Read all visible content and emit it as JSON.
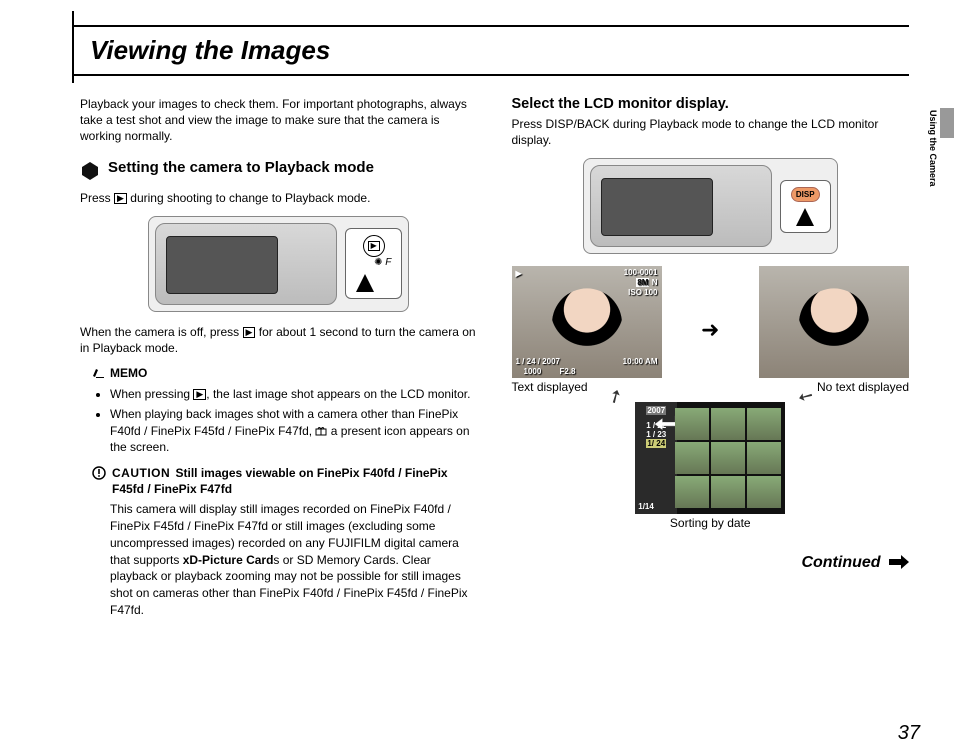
{
  "page_title": "Viewing the Images",
  "page_number": "37",
  "side_tab": "Using the Camera",
  "left": {
    "intro": "Playback your images to check them. For important photographs, always take a test shot and view the image to make sure that the camera is working normally.",
    "subhead": "Setting the camera to Playback mode",
    "press_during_a": "Press ",
    "press_during_b": " during shooting to change to Playback mode.",
    "cam_off_a": "When the camera is off, press ",
    "cam_off_b": " for about 1 second to turn the camera on in Playback mode.",
    "memo_label": "MEMO",
    "memo1_a": "When pressing ",
    "memo1_b": ", the last image shot appears on the LCD monitor.",
    "memo2_a": "When playing back images shot with a camera other than FinePix F40fd / FinePix F45fd / FinePix F47fd, ",
    "memo2_b": " a present icon appears on the screen.",
    "caution_label": "CAUTION",
    "caution_title": " Still images viewable on FinePix F40fd / FinePix F45fd / FinePix F47fd",
    "caution_body_a": "This camera will display still images recorded on FinePix F40fd / FinePix F45fd / FinePix F47fd or still images (excluding some uncompressed images) recorded on any FUJIFILM digital camera that supports ",
    "caution_body_bold": "xD-Picture Card",
    "caution_body_b": "s or SD Memory Cards. Clear playback or playback zooming may not be possible for still images shot on cameras other than FinePix F40fd / FinePix F45fd / FinePix F47fd."
  },
  "right": {
    "subhead": "Select the LCD monitor display.",
    "intro": "Press DISP/BACK during Playback mode to change the LCD monitor display.",
    "disp_label": "DISP",
    "osd": {
      "file": "100-0001",
      "size": "8M",
      "mode": "N",
      "iso": "ISO 100",
      "date": "1 / 24 / 2007",
      "time": "10:00 AM",
      "shutter": "1000",
      "fnum": "F2.8"
    },
    "caption_text": "Text displayed",
    "caption_notext": "No text displayed",
    "sort": {
      "year": "2007",
      "d1": "1 / 22",
      "d2": "1 / 23",
      "d3": "1/ 24",
      "counter": "1/14",
      "caption": "Sorting by date"
    },
    "continued": "Continued"
  }
}
